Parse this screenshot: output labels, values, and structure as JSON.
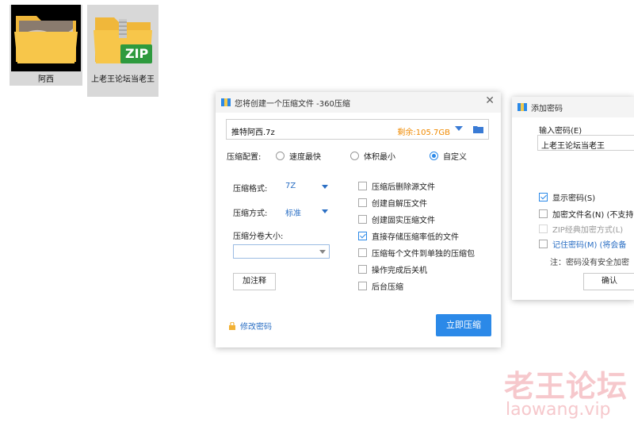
{
  "desktop": {
    "icons": [
      {
        "label": "阿西",
        "icon": "image-folder-icon"
      },
      {
        "label": "上老王论坛当老王",
        "icon": "zip-archive-icon",
        "badge": "ZIP"
      }
    ]
  },
  "compress_dialog": {
    "title": "您将创建一个压缩文件 -360压缩",
    "filename": "推特阿西.7z",
    "free_space": "剩余:105.7GB",
    "config_label": "压缩配置:",
    "presets": [
      {
        "label": "速度最快",
        "selected": false
      },
      {
        "label": "体积最小",
        "selected": false
      },
      {
        "label": "自定义",
        "selected": true
      }
    ],
    "format_label": "压缩格式:",
    "format_value": "7Z",
    "method_label": "压缩方式:",
    "method_value": "标准",
    "volume_label": "压缩分卷大小:",
    "volume_value": "",
    "comment_button": "加注释",
    "options": [
      {
        "label": "压缩后删除源文件",
        "checked": false
      },
      {
        "label": "创建自解压文件",
        "checked": false
      },
      {
        "label": "创建固实压缩文件",
        "checked": false
      },
      {
        "label": "直接存储压缩率低的文件",
        "checked": true
      },
      {
        "label": "压缩每个文件到单独的压缩包",
        "checked": false
      },
      {
        "label": "操作完成后关机",
        "checked": false
      },
      {
        "label": "后台压缩",
        "checked": false
      }
    ],
    "change_password": "修改密码",
    "start_button": "立即压缩"
  },
  "password_dialog": {
    "title": "添加密码",
    "input_label": "输入密码(E)",
    "password_value": "上老王论坛当老王",
    "show_password": {
      "label": "显示密码(S)",
      "checked": true
    },
    "encrypt_filenames": {
      "label": "加密文件名(N) (不支持",
      "checked": false
    },
    "zip_classic": {
      "label": "ZIP经典加密方式(L)",
      "checked": false,
      "disabled": true
    },
    "remember_link": "记住密码(M)",
    "remember_tail": "(将会备",
    "note": "注：密码没有安全加密",
    "ok_button": "确认"
  },
  "watermark": {
    "cn": "老王论坛",
    "en": "laowang.vip"
  },
  "colors": {
    "accent": "#2b89e8",
    "warning": "#f08a00",
    "link": "#2b6fc4",
    "watermark": "#f6c8cc"
  }
}
